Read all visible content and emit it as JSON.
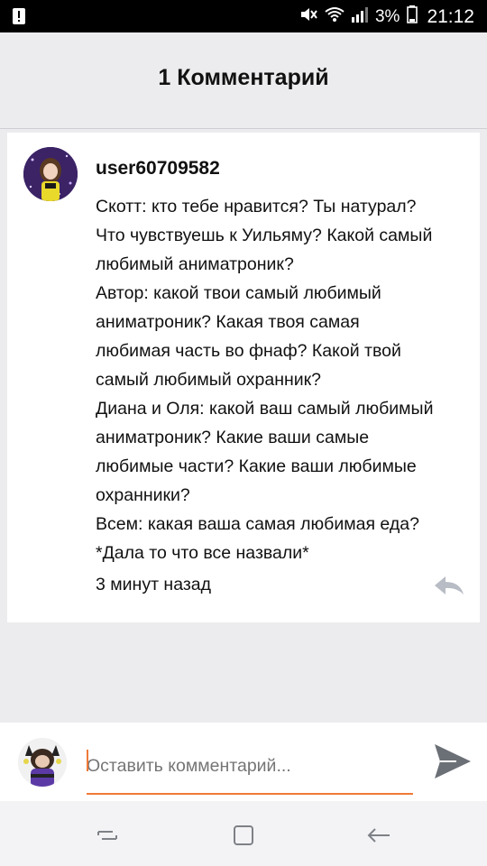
{
  "status_bar": {
    "battery_percent": "3%",
    "time": "21:12",
    "icons": [
      "notification-warning-icon",
      "mute-icon",
      "wifi-icon",
      "signal-icon",
      "battery-icon"
    ]
  },
  "header": {
    "title": "1 Комментарий"
  },
  "comment": {
    "username": "user60709582",
    "lines": [
      "Скотт: кто тебе нравится? Ты натурал?",
      "Что чувствуешь к Уильяму? Какой самый",
      "любимый аниматроник?",
      "Автор: какой твои самый любимый",
      "аниматроник? Какая твоя самая",
      "любимая часть во фнаф? Какой твой",
      "самый любимый охранник?",
      "Диана и Оля: какой ваш самый любимый",
      "аниматроник? Какие ваши самые",
      "любимые части? Какие ваши любимые",
      "охранники?",
      "Всем: какая ваша самая любимая еда?",
      "*Дала то что все назвали*"
    ],
    "timestamp": "3 минут назад",
    "reply_icon": "reply-icon"
  },
  "compose": {
    "placeholder": "Оставить комментарий...",
    "value": "",
    "send_icon": "send-icon"
  },
  "nav_bar": {
    "icons": [
      "recents-icon",
      "home-icon",
      "back-icon"
    ]
  },
  "colors": {
    "accent": "#ef7a38",
    "background": "#ececee",
    "card": "#ffffff",
    "status_bar": "#000000"
  }
}
